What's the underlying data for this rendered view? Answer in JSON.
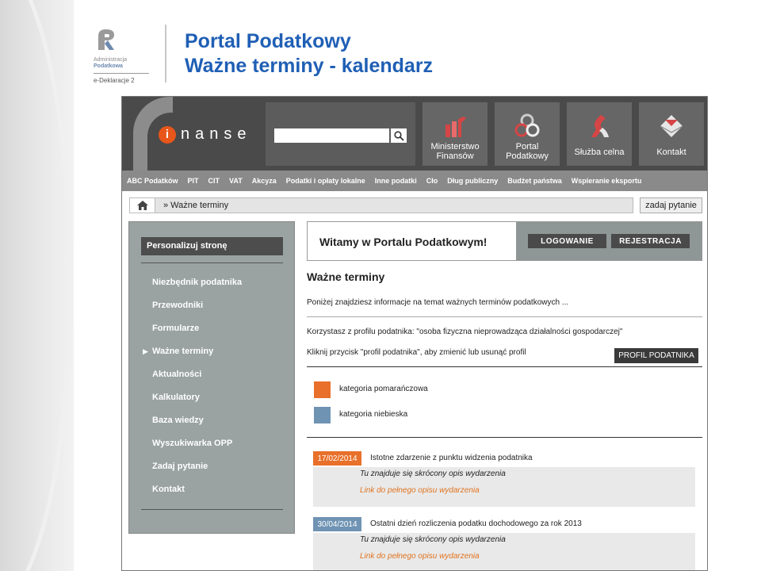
{
  "slide": {
    "title_line1": "Portal Podatkowy",
    "title_line2": "Ważne terminy - kalendarz",
    "logo": {
      "line1": "Administracja",
      "line2": "Podatkowa",
      "sub": "e-Deklaracje 2"
    }
  },
  "portal": {
    "brand_i": "i",
    "brand_rest": "nanse",
    "search": {
      "placeholder": ""
    },
    "tiles": [
      {
        "label": "Ministerstwo Finansów"
      },
      {
        "label": "Portal Podatkowy"
      },
      {
        "label": "Służba celna"
      },
      {
        "label": "Kontakt"
      }
    ],
    "menu": [
      "ABC Podatków",
      "PIT",
      "CIT",
      "VAT",
      "Akcyza",
      "Podatki i opłaty lokalne",
      "Inne podatki",
      "Cło",
      "Dług publiczny",
      "Budżet państwa",
      "Wspieranie eksportu"
    ],
    "breadcrumb": "» Ważne terminy",
    "ask_button": "zadaj pytanie",
    "sidebar": {
      "personalize": "Personalizuj stronę",
      "items": [
        "Niezbędnik podatnika",
        "Przewodniki",
        "Formularze",
        "Ważne terminy",
        "Aktualności",
        "Kalkulatory",
        "Baza wiedzy",
        "Wyszukiwarka OPP",
        "Zadaj pytanie",
        "Kontakt"
      ],
      "active_index": 3
    },
    "welcome": "Witamy w Portalu Podatkowym!",
    "login": "LOGOWANIE",
    "register": "REJESTRACJA",
    "heading": "Ważne terminy",
    "intro": "Poniżej znajdziesz informacje na temat ważnych terminów podatkowych ...",
    "profile_text": "Korzystasz z profilu podatnika: \"osoba fizyczna nieprowadząca działalności gospodarczej\"",
    "profile_hint": "Kliknij przycisk \"profil podatnika\", aby zmienić lub usunąć profil",
    "profile_button": "PROFIL PODATNIKA",
    "legend": [
      {
        "label": "kategoria pomarańczowa",
        "color": "#e8702a"
      },
      {
        "label": "kategoria niebieska",
        "color": "#6f93b3"
      }
    ],
    "events": [
      {
        "date": "17/02/2014",
        "title": "Istotne zdarzenie z punktu widzenia podatnika",
        "desc": "Tu znajduje się skrócony opis wydarzenia",
        "link": "Link do pełnego opisu wydarzenia",
        "color": "#e8702a"
      },
      {
        "date": "30/04/2014",
        "title": "Ostatni dzień rozliczenia podatku dochodowego za rok 2013",
        "desc": "Tu znajduje się skrócony opis wydarzenia",
        "link": "Link do pełnego opisu wydarzenia",
        "color": "#6f93b3"
      }
    ]
  }
}
